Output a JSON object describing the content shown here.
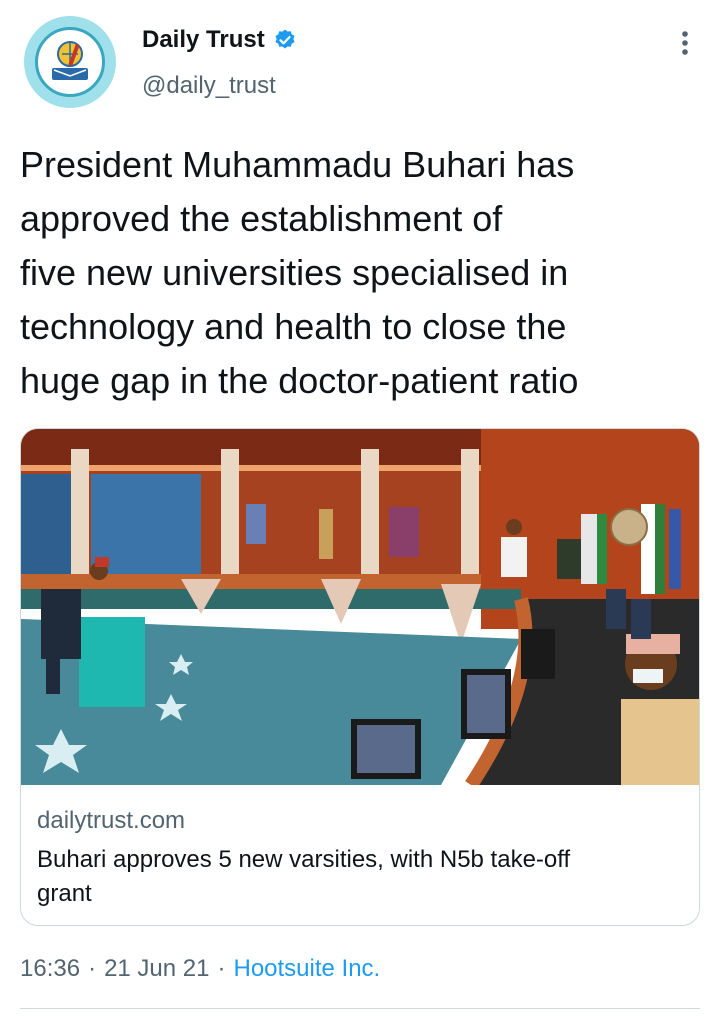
{
  "author": {
    "display_name": "Daily Trust",
    "handle": "@daily_trust",
    "verified": true,
    "avatar_icon": "daily-trust-logo"
  },
  "tweet": {
    "lines": [
      "President Muhammadu Buhari has",
      "approved the establishment of",
      "five new universities specialised in",
      "technology and health to close the",
      "huge gap in the doctor-patient ratio"
    ]
  },
  "link_card": {
    "image_alt_icon": "council-chamber-photo",
    "domain": "dailytrust.com",
    "title_line1": "Buhari approves 5 new varsities, with N5b take-off",
    "title_line2": "grant"
  },
  "meta": {
    "time": "16:36",
    "date": "21 Jun 21",
    "separator": "·",
    "source": "Hootsuite Inc."
  },
  "colors": {
    "accent": "#1d9bf0",
    "secondary_text": "#536471",
    "primary_text": "#0f1419",
    "border": "#cfd9de"
  }
}
